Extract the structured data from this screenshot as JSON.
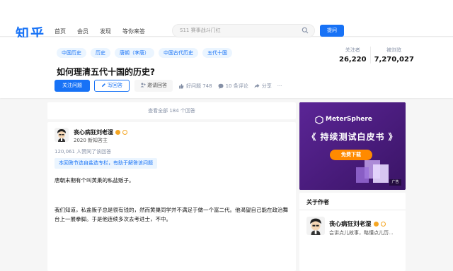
{
  "header": {
    "logo": "知乎",
    "nav": [
      "首页",
      "会员",
      "发现",
      "等你来答"
    ],
    "search_placeholder": "S11 赛事战斗门红",
    "ask_label": "提问"
  },
  "question": {
    "tags": [
      "中国历史",
      "历史",
      "唐朝（李唐）",
      "中国古代历史",
      "五代十国"
    ],
    "title": "如何理清五代十国的历史?",
    "follow_label": "关注问题",
    "write_label": "写回答",
    "invite_label": "邀请回答",
    "good_label": "好问题 748",
    "comments_label": "10 条评论",
    "share_label": "分享",
    "more_label": "···",
    "stats": [
      {
        "label": "关注者",
        "value": "26,220"
      },
      {
        "label": "被浏览",
        "value": "7,270,027"
      }
    ]
  },
  "answers": {
    "view_all": "查看全部 184 个回答",
    "author_name": "丧心病狂刘老湿",
    "author_sub": "2020 新知答主",
    "agree_text": "120,061 人赞同了该回答",
    "notice": "本回答节选自盐选专栏，有助于解答该问题",
    "paragraphs": [
      "唐朝末期有个叫黄巢的私盐贩子。",
      "我们知道，私盐贩子总是很有钱的，然而黄巢同学并不满足于做一个富二代。他渴望自己能在政治舞台上一展拳脚。于是他连续多次去考进士，不中。"
    ]
  },
  "sidebar": {
    "ad_brand": "MeterSphere",
    "ad_title": "《 持续测试白皮书 》",
    "ad_cta": "免费下载",
    "ad_label": "广告",
    "author_card_title": "关于作者",
    "author_name": "丧心病狂刘老湿",
    "author_bio": "会讲点儿故事，略懂点儿历..."
  },
  "colors": {
    "brand_blue": "#1772f6",
    "ad_purple": "#4a1d7f",
    "ad_orange": "#ff8a00"
  }
}
